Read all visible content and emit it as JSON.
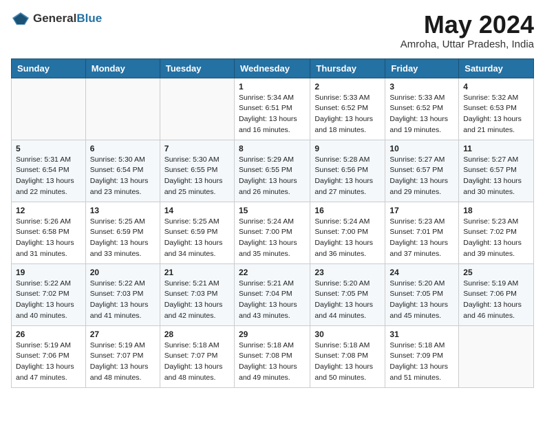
{
  "header": {
    "logo": {
      "general": "General",
      "blue": "Blue"
    },
    "title": "May 2024",
    "subtitle": "Amroha, Uttar Pradesh, India"
  },
  "calendar": {
    "weekdays": [
      "Sunday",
      "Monday",
      "Tuesday",
      "Wednesday",
      "Thursday",
      "Friday",
      "Saturday"
    ],
    "weeks": [
      [
        {
          "day": "",
          "info": ""
        },
        {
          "day": "",
          "info": ""
        },
        {
          "day": "",
          "info": ""
        },
        {
          "day": "1",
          "info": "Sunrise: 5:34 AM\nSunset: 6:51 PM\nDaylight: 13 hours\nand 16 minutes."
        },
        {
          "day": "2",
          "info": "Sunrise: 5:33 AM\nSunset: 6:52 PM\nDaylight: 13 hours\nand 18 minutes."
        },
        {
          "day": "3",
          "info": "Sunrise: 5:33 AM\nSunset: 6:52 PM\nDaylight: 13 hours\nand 19 minutes."
        },
        {
          "day": "4",
          "info": "Sunrise: 5:32 AM\nSunset: 6:53 PM\nDaylight: 13 hours\nand 21 minutes."
        }
      ],
      [
        {
          "day": "5",
          "info": "Sunrise: 5:31 AM\nSunset: 6:54 PM\nDaylight: 13 hours\nand 22 minutes."
        },
        {
          "day": "6",
          "info": "Sunrise: 5:30 AM\nSunset: 6:54 PM\nDaylight: 13 hours\nand 23 minutes."
        },
        {
          "day": "7",
          "info": "Sunrise: 5:30 AM\nSunset: 6:55 PM\nDaylight: 13 hours\nand 25 minutes."
        },
        {
          "day": "8",
          "info": "Sunrise: 5:29 AM\nSunset: 6:55 PM\nDaylight: 13 hours\nand 26 minutes."
        },
        {
          "day": "9",
          "info": "Sunrise: 5:28 AM\nSunset: 6:56 PM\nDaylight: 13 hours\nand 27 minutes."
        },
        {
          "day": "10",
          "info": "Sunrise: 5:27 AM\nSunset: 6:57 PM\nDaylight: 13 hours\nand 29 minutes."
        },
        {
          "day": "11",
          "info": "Sunrise: 5:27 AM\nSunset: 6:57 PM\nDaylight: 13 hours\nand 30 minutes."
        }
      ],
      [
        {
          "day": "12",
          "info": "Sunrise: 5:26 AM\nSunset: 6:58 PM\nDaylight: 13 hours\nand 31 minutes."
        },
        {
          "day": "13",
          "info": "Sunrise: 5:25 AM\nSunset: 6:59 PM\nDaylight: 13 hours\nand 33 minutes."
        },
        {
          "day": "14",
          "info": "Sunrise: 5:25 AM\nSunset: 6:59 PM\nDaylight: 13 hours\nand 34 minutes."
        },
        {
          "day": "15",
          "info": "Sunrise: 5:24 AM\nSunset: 7:00 PM\nDaylight: 13 hours\nand 35 minutes."
        },
        {
          "day": "16",
          "info": "Sunrise: 5:24 AM\nSunset: 7:00 PM\nDaylight: 13 hours\nand 36 minutes."
        },
        {
          "day": "17",
          "info": "Sunrise: 5:23 AM\nSunset: 7:01 PM\nDaylight: 13 hours\nand 37 minutes."
        },
        {
          "day": "18",
          "info": "Sunrise: 5:23 AM\nSunset: 7:02 PM\nDaylight: 13 hours\nand 39 minutes."
        }
      ],
      [
        {
          "day": "19",
          "info": "Sunrise: 5:22 AM\nSunset: 7:02 PM\nDaylight: 13 hours\nand 40 minutes."
        },
        {
          "day": "20",
          "info": "Sunrise: 5:22 AM\nSunset: 7:03 PM\nDaylight: 13 hours\nand 41 minutes."
        },
        {
          "day": "21",
          "info": "Sunrise: 5:21 AM\nSunset: 7:03 PM\nDaylight: 13 hours\nand 42 minutes."
        },
        {
          "day": "22",
          "info": "Sunrise: 5:21 AM\nSunset: 7:04 PM\nDaylight: 13 hours\nand 43 minutes."
        },
        {
          "day": "23",
          "info": "Sunrise: 5:20 AM\nSunset: 7:05 PM\nDaylight: 13 hours\nand 44 minutes."
        },
        {
          "day": "24",
          "info": "Sunrise: 5:20 AM\nSunset: 7:05 PM\nDaylight: 13 hours\nand 45 minutes."
        },
        {
          "day": "25",
          "info": "Sunrise: 5:19 AM\nSunset: 7:06 PM\nDaylight: 13 hours\nand 46 minutes."
        }
      ],
      [
        {
          "day": "26",
          "info": "Sunrise: 5:19 AM\nSunset: 7:06 PM\nDaylight: 13 hours\nand 47 minutes."
        },
        {
          "day": "27",
          "info": "Sunrise: 5:19 AM\nSunset: 7:07 PM\nDaylight: 13 hours\nand 48 minutes."
        },
        {
          "day": "28",
          "info": "Sunrise: 5:18 AM\nSunset: 7:07 PM\nDaylight: 13 hours\nand 48 minutes."
        },
        {
          "day": "29",
          "info": "Sunrise: 5:18 AM\nSunset: 7:08 PM\nDaylight: 13 hours\nand 49 minutes."
        },
        {
          "day": "30",
          "info": "Sunrise: 5:18 AM\nSunset: 7:08 PM\nDaylight: 13 hours\nand 50 minutes."
        },
        {
          "day": "31",
          "info": "Sunrise: 5:18 AM\nSunset: 7:09 PM\nDaylight: 13 hours\nand 51 minutes."
        },
        {
          "day": "",
          "info": ""
        }
      ]
    ]
  }
}
